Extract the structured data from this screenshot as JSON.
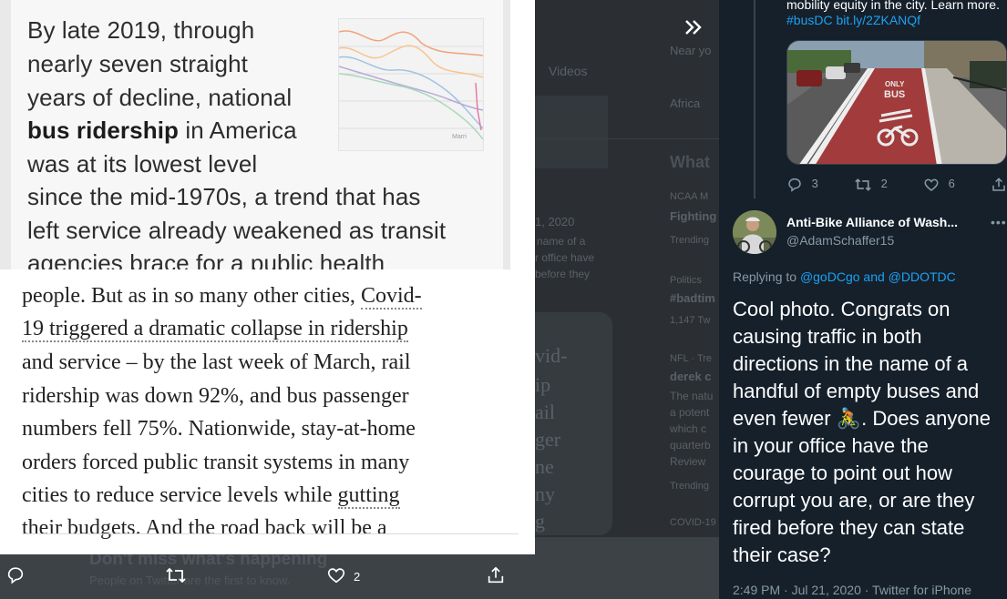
{
  "article": {
    "sans_lines": [
      "By late 2019, through",
      "nearly seven straight",
      "years of decline, national",
      "in America",
      "was at its lowest level",
      "since the mid-1970s, a trend that has",
      "left service already weakened as transit",
      "agencies brace for a public health"
    ],
    "sans_bold": "bus ridership",
    "chart_label": "Marri",
    "serif_lines": [
      "people. But as in so many other cities,",
      "Covid-",
      "19 triggered a dramatic collapse in ridership",
      "and service – by the last week of March, rail",
      "ridership was down 92%, and bus passenger",
      "numbers fell 75%. Nationwide, stay-at-home",
      "orders forced public transit systems in many",
      "cities to reduce service levels while",
      "gutting",
      "their budgets. And the road back will be a"
    ]
  },
  "photo_bar": {
    "reply_icon": "reply-icon",
    "retweet_icon": "retweet-icon",
    "like_icon": "heart-icon",
    "like_count": "2",
    "share_icon": "share-icon"
  },
  "background_timeline": {
    "fragments": [
      "Videos",
      "Near yo",
      "Africa",
      "What",
      "NCAA M",
      "Fighting",
      "Trending",
      "1, 2020",
      "name of a",
      "r office have",
      "before they",
      "Politics",
      "#badtim",
      "1,147 Tw",
      "NFL · Tre",
      "derek c",
      "The natu",
      "a potent",
      "which c",
      "quarterb",
      "Review",
      "Trending",
      "COVID-19",
      "vid-",
      "ip",
      "ail",
      "ger",
      "ne",
      "ny",
      "g"
    ],
    "dont_miss": "Don't miss what's happening",
    "dont_miss_sub": "People on Twitter are the first to know."
  },
  "prev_tweet": {
    "text": "mobility equity in the city. Learn more.",
    "hashtag": "#busDC",
    "link": "bit.ly/2ZKANQf",
    "image_text_1": "ONLY",
    "image_text_2": "BUS",
    "reply_count": "3",
    "retweet_count": "2",
    "like_count": "6"
  },
  "tweet": {
    "display_name": "Anti-Bike Alliance of Wash...",
    "handle": "@AdamSchaffer15",
    "replying_label": "Replying to",
    "replying_to_1": "@goDCgo",
    "replying_and": "and",
    "replying_to_2": "@DDOTDC",
    "text_before_emoji": "Cool photo. Congrats on causing traffic in both directions in the name of a handful of empty buses and even fewer",
    "emoji": "🚴",
    "text_after_emoji": ". Does anyone in your office have the courage to point out how corrupt you are, or are they fired before they can state their case?",
    "timestamp": "2:49 PM · Jul 21, 2020 · Twitter for iPhone"
  },
  "colors": {
    "accent": "#1da1f2",
    "pane_bg": "#15202b",
    "muted": "#8899a6"
  }
}
